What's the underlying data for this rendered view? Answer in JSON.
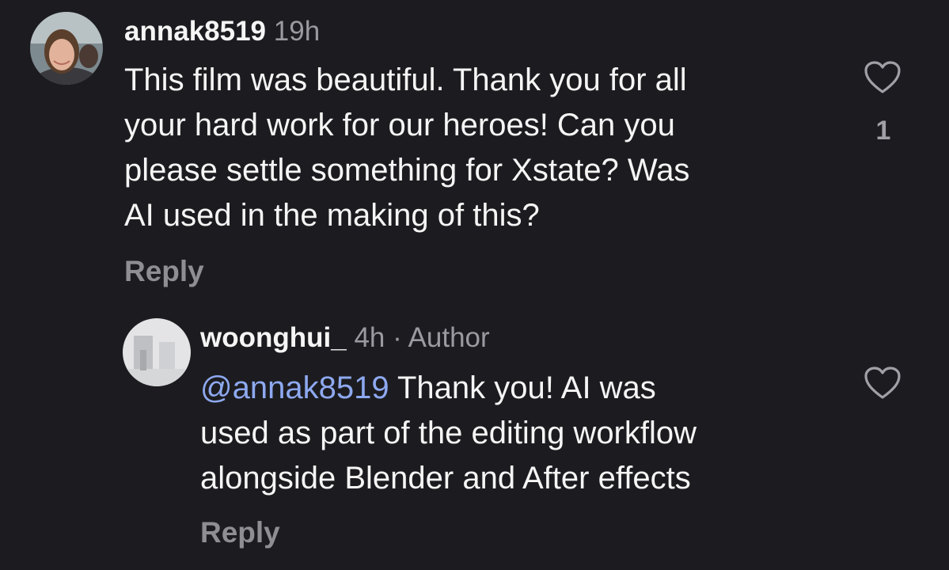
{
  "comments": [
    {
      "username": "annak8519",
      "time": "19h",
      "lines": [
        "This film was beautiful. Thank you for all",
        "your hard work for our heroes!  Can you",
        "please settle something for Xstate? Was",
        "AI used in the making of this?"
      ],
      "reply_label": "Reply",
      "like_count": "1",
      "icons": {
        "like": "heart-icon",
        "avatar": "avatar-photo"
      }
    },
    {
      "username": "woonghui_",
      "time": "4h",
      "separator": "·",
      "author_tag": "Author",
      "mention": "@annak8519",
      "first_line_rest": " Thank you! AI was",
      "lines": [
        "used as part of the editing workflow",
        "alongside Blender and After effects"
      ],
      "reply_label": "Reply",
      "icons": {
        "like": "heart-icon",
        "avatar": "avatar-photo"
      }
    }
  ],
  "colors": {
    "background": "#1c1c20",
    "text": "#f5f5f5",
    "secondary": "#9a9aa0",
    "mention": "#8ea9f0"
  }
}
